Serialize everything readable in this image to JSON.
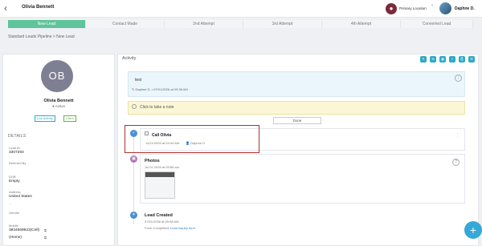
{
  "header": {
    "contact_name": "Olivia Bennett",
    "primary_location": "Primary Location",
    "user_name": "Daphne D."
  },
  "stages": [
    "New Lead",
    "Contact Made",
    "2nd Attempt",
    "3rd Attempt",
    "4th Attempt",
    "Converted Lead"
  ],
  "active_stage": "New Lead",
  "breadcrumb": "Standard Leads Pipeline  >  New Lead",
  "profile": {
    "initials": "OB",
    "name": "Olivia Bennett",
    "status": "Active",
    "badges": [
      "Low Activity",
      "Client"
    ],
    "details_heading": "DETAILS",
    "lead_id_label": "Lead ID",
    "lead_id": "3307293",
    "referred_by_label": "Referred By",
    "dob_label": "DOB",
    "dob": "Empty",
    "address_label": "Address",
    "address": "United States",
    "address_tail": "-",
    "gender_label": "Gender",
    "mobile_label": "Mobile",
    "mobile": "3834569923(Cell)",
    "mobile_type": "(Home)"
  },
  "activity": {
    "title": "Activity",
    "note_text": "test",
    "note_meta": "Daphne D.  •  07/01/2026 at 09:38 AM",
    "take_note": "Click to take a note",
    "done_label": "Done",
    "call_title": "Call Olivia",
    "call_date": "11/21/2026 at 04:44 AM",
    "call_user": "Daphne D",
    "photos_title": "Photos",
    "photos_date": "Jul 01 2026 at 09:58 am",
    "lead_created_title": "Lead Created",
    "lead_created_date": "07/01/2026 at 09:58 AM",
    "lead_form_label": "Form Completed: ",
    "lead_form_link": "Lead inquiry form"
  },
  "colors": {
    "active_stage": "#5ec49a",
    "accent": "#35a8d8",
    "highlight_outline": "#b03030"
  }
}
